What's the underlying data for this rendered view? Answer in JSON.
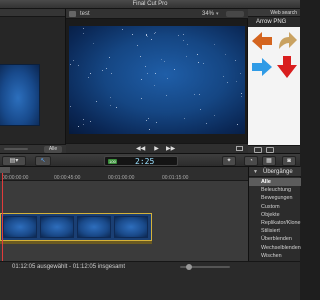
{
  "window": {
    "title": "Final Cut Pro"
  },
  "browser": {
    "filter_label": "Alle"
  },
  "viewer": {
    "title": "test",
    "zoom": "34%",
    "transport": {
      "prev": "◀◀",
      "play": "▶",
      "next": "▶▶"
    }
  },
  "library": {
    "header": "Web search",
    "filename": "Arrow PNG",
    "tiles": [
      {
        "icon": "arrow-left-orange-icon",
        "color": "#d4641e"
      },
      {
        "icon": "arrow-curved-gold-icon",
        "color": "#c9a261"
      },
      {
        "icon": "arrow-right-blue-icon",
        "color": "#2f9be6"
      },
      {
        "icon": "arrow-down-red-icon",
        "color": "#d91e1e"
      }
    ]
  },
  "toolbar": {
    "clip_icon": "clip-appearance-icon",
    "arrow_tool": "↖",
    "timecode_badge": "100",
    "timecode": "2:25"
  },
  "timeline": {
    "ticks": [
      "00:00:00:00",
      "00:00:45:00",
      "00:01:00:00",
      "00:01:15:00"
    ]
  },
  "effects": {
    "title": "Übergänge",
    "items": [
      {
        "label": "Alle",
        "selected": true
      },
      {
        "label": "Beleuchtung",
        "selected": false
      },
      {
        "label": "Bewegungen",
        "selected": false
      },
      {
        "label": "Custom",
        "selected": false
      },
      {
        "label": "Objekte",
        "selected": false
      },
      {
        "label": "Replikator/Klone",
        "selected": false
      },
      {
        "label": "Stilisiert",
        "selected": false
      },
      {
        "label": "Überblenden",
        "selected": false
      },
      {
        "label": "Wechselblenden",
        "selected": false
      },
      {
        "label": "Wischen",
        "selected": false
      }
    ]
  },
  "status": {
    "text": "01:12:05 ausgewählt - 01:12:05 insgesamt"
  }
}
